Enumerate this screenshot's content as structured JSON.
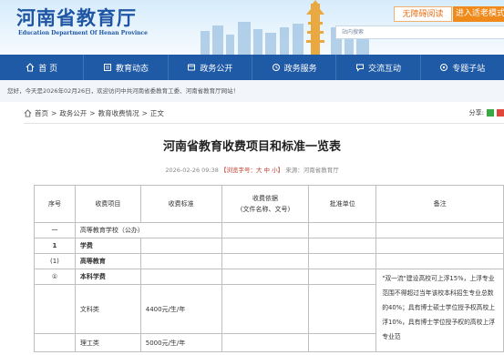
{
  "header": {
    "title": "河南省教育厅",
    "subtitle": "Education Department Of Henan Province",
    "accessible_btn": "无障碍阅读",
    "elder_btn": "进入适老模式",
    "search_placeholder": "站内搜索"
  },
  "nav": [
    {
      "icon": "home-icon",
      "label": "首 页"
    },
    {
      "icon": "news-icon",
      "label": "教育动态"
    },
    {
      "icon": "gov-icon",
      "label": "政务公开"
    },
    {
      "icon": "service-icon",
      "label": "政务服务"
    },
    {
      "icon": "interact-icon",
      "label": "交流互动"
    },
    {
      "icon": "topic-icon",
      "label": "专题子站"
    }
  ],
  "welcome": "您好，今天是2026年02月26日，欢迎访问中共河南省委教育工委、河南省教育厅网站！",
  "breadcrumb": [
    "首页",
    "政务公开",
    "教育收费情况",
    "正文"
  ],
  "share_label": "分享:",
  "article": {
    "title": "河南省教育收费项目和标准一览表",
    "date": "2026-02-26 09:38",
    "size_prefix": "【浏览字号：",
    "size_options": "大 中 小",
    "size_suffix": "】",
    "source": "来源：河南省教育厅"
  },
  "table": {
    "headers": [
      "序号",
      "收费项目",
      "收费标准",
      "收费依据\n(文件名称、文号)",
      "批准单位",
      "备注"
    ],
    "rows": [
      [
        "一",
        "高等教育学校（公办）"
      ],
      [
        "1",
        "学费"
      ],
      [
        "(1)",
        "高等教育"
      ],
      [
        "①",
        "本科学费"
      ],
      [
        "",
        "文科类",
        "4400元/生/年"
      ],
      [
        "",
        "理工类",
        "5000元/生/年"
      ]
    ],
    "note": "\"双一流\"建设高校可上浮15%，上浮专业范围不得超过当年该校本科招生专业总数的40%；具有博士硕士学位授予权高校上浮10%，具有博士学位授予权的高校上浮专业范"
  }
}
